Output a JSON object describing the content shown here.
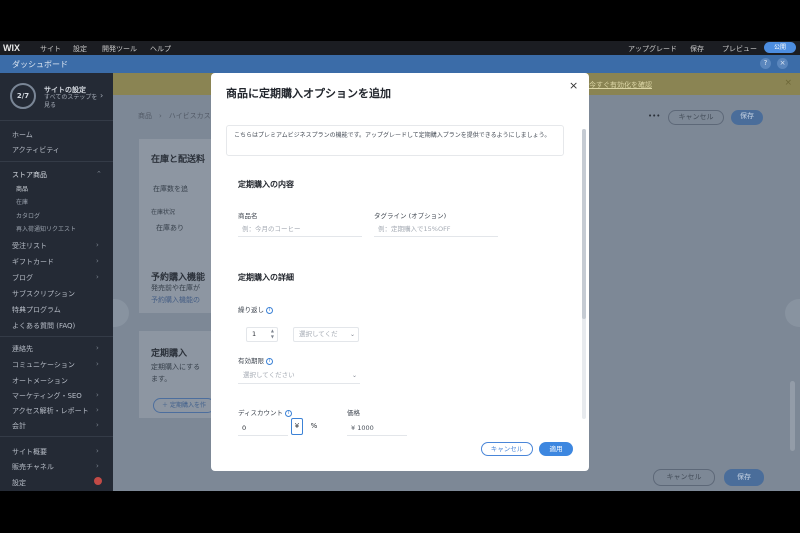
{
  "topnav": {
    "logo": "WIX",
    "items": [
      "サイト",
      "設定",
      "開発ツール",
      "ヘルプ"
    ],
    "right_items": [
      "アップグレード",
      "保存",
      "プレビュー"
    ],
    "upgrade": "公開"
  },
  "dashbar": {
    "title": "ダッシュボード",
    "help_icon": "?",
    "close_icon": "×"
  },
  "sidebar": {
    "progress": {
      "count": "2/7",
      "title": "サイトの設定",
      "subtitle": "すべてのステップを見る",
      "chevron": "›"
    },
    "items_top": [
      "ホーム",
      "アクティビティ"
    ],
    "store": {
      "label": "ストア商品",
      "chevron": "⌃",
      "subitems": [
        "商品",
        "在庫",
        "カタログ",
        "再入荷通知リクエスト"
      ]
    },
    "items_mid": [
      {
        "label": "受注リスト",
        "chevron": "›"
      },
      {
        "label": "ギフトカード",
        "chevron": "›"
      },
      {
        "label": "ブログ",
        "chevron": "›"
      },
      {
        "label": "サブスクリプション",
        "chevron": ""
      },
      {
        "label": "特典プログラム",
        "chevron": ""
      },
      {
        "label": "よくある質問 (FAQ)",
        "chevron": ""
      }
    ],
    "items_low": [
      {
        "label": "連絡先",
        "chevron": "›"
      },
      {
        "label": "コミュニケーション",
        "chevron": "›"
      },
      {
        "label": "オートメーション",
        "chevron": ""
      },
      {
        "label": "マーケティング・SEO",
        "chevron": "›"
      },
      {
        "label": "アクセス解析・レポート",
        "chevron": "›"
      },
      {
        "label": "会計",
        "chevron": "›"
      }
    ],
    "items_bottom": [
      {
        "label": "サイト概要",
        "chevron": "›"
      },
      {
        "label": "販売チャネル",
        "chevron": "›"
      },
      {
        "label": "設定",
        "chevron": ""
      }
    ]
  },
  "banner": {
    "link": "今すぐ有効化を確認",
    "close": "×"
  },
  "background": {
    "breadcrumb": "商品　›　ハイビスカス",
    "more": "•••",
    "cancel": "キャンセル",
    "save": "保存",
    "inventory_title": "在庫と配送料",
    "inventory_toggle": "在庫数を追",
    "inventory_status_label": "在庫状況",
    "inventory_status_value": "在庫あり",
    "preorder_title": "予約購入機能",
    "preorder_text": "発売前や在庫が",
    "preorder_link": "予約購入機能の",
    "subs_title": "定期購入",
    "subs_text1": "定期購入にする",
    "subs_text2": "ます。",
    "subs_button": "＋ 定期購入を作",
    "footer_cancel": "キャンセル",
    "footer_save": "保存"
  },
  "modal": {
    "title": "商品に定期購入オプションを追加",
    "close": "×",
    "notice": "こちらはプレミアムビジネスプランの機能です。アップグレードして定期購入プランを提供できるようにしましょう。",
    "content_header": "定期購入の内容",
    "name_label": "商品名",
    "name_placeholder": "例：今月のコーヒー",
    "tagline_label": "タグライン (オプション)",
    "tagline_placeholder": "例：定期購入で15%OFF",
    "details_header": "定期購入の詳細",
    "repeat_label": "繰り返し",
    "repeat_value": "1",
    "repeat_select": "選択してくだ",
    "period_label": "有効期限",
    "period_select": "選択してください",
    "discount_label": "ディスカウント",
    "discount_value": "0",
    "yen": "¥",
    "percent": "%",
    "price_label": "価格",
    "price_value": "¥ 1000",
    "cancel": "キャンセル",
    "apply": "適用"
  }
}
